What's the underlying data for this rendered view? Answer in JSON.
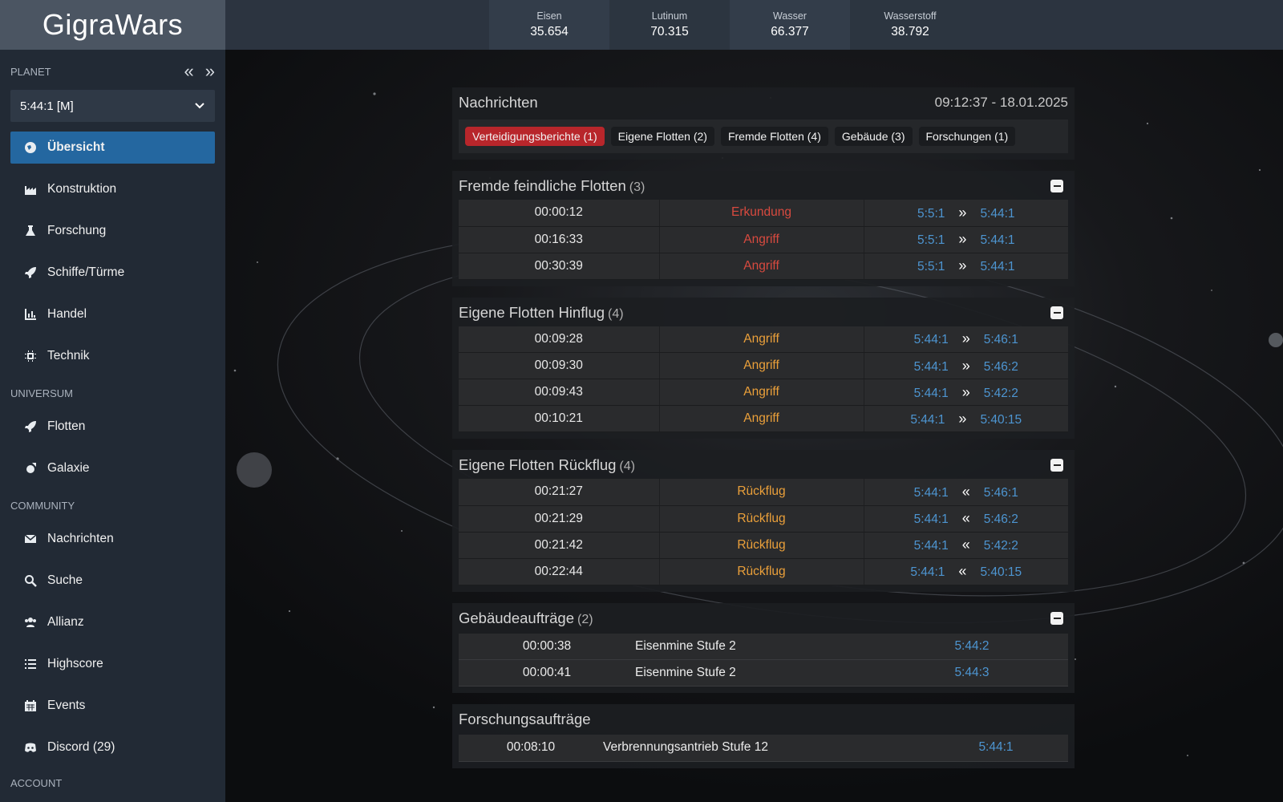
{
  "app": {
    "title": "GigraWars"
  },
  "sidebar": {
    "planet_label": "PLANET",
    "planet_value": "5:44:1 [M]",
    "prev_icon": "«",
    "next_icon": "»",
    "nav_main": [
      {
        "label": "Übersicht",
        "icon": "globe-icon",
        "active": true
      },
      {
        "label": "Konstruktion",
        "icon": "factory-icon"
      },
      {
        "label": "Forschung",
        "icon": "flask-icon"
      },
      {
        "label": "Schiffe/Türme",
        "icon": "rocket-icon"
      },
      {
        "label": "Handel",
        "icon": "chart-icon"
      },
      {
        "label": "Technik",
        "icon": "chip-icon"
      }
    ],
    "universum_label": "UNIVERSUM",
    "nav_universum": [
      {
        "label": "Flotten",
        "icon": "rocket-icon"
      },
      {
        "label": "Galaxie",
        "icon": "galaxy-icon"
      }
    ],
    "community_label": "COMMUNITY",
    "nav_community": [
      {
        "label": "Nachrichten",
        "icon": "envelope-icon"
      },
      {
        "label": "Suche",
        "icon": "search-icon"
      },
      {
        "label": "Allianz",
        "icon": "users-icon"
      },
      {
        "label": "Highscore",
        "icon": "list-icon"
      },
      {
        "label": "Events",
        "icon": "calendar-icon"
      },
      {
        "label": "Discord (29)",
        "icon": "discord-icon"
      }
    ],
    "account_label": "ACCOUNT"
  },
  "resources": [
    {
      "name": "Eisen",
      "value": "35.654"
    },
    {
      "name": "Lutinum",
      "value": "70.315"
    },
    {
      "name": "Wasser",
      "value": "66.377"
    },
    {
      "name": "Wasserstoff",
      "value": "38.792"
    }
  ],
  "messages": {
    "title": "Nachrichten",
    "timestamp": "09:12:37 - 18.01.2025",
    "tabs": [
      {
        "label": "Verteidigungsberichte (1)",
        "alert": true
      },
      {
        "label": "Eigene Flotten (2)"
      },
      {
        "label": "Fremde Flotten (4)"
      },
      {
        "label": "Gebäude (3)"
      },
      {
        "label": "Forschungen (1)"
      }
    ]
  },
  "hostile_fleets": {
    "title": "Fremde feindliche Flotten",
    "count": "(3)",
    "rows": [
      {
        "time": "00:00:12",
        "mission": "Erkundung",
        "from": "5:5:1",
        "dir": "»",
        "to": "5:44:1"
      },
      {
        "time": "00:16:33",
        "mission": "Angriff",
        "from": "5:5:1",
        "dir": "»",
        "to": "5:44:1"
      },
      {
        "time": "00:30:39",
        "mission": "Angriff",
        "from": "5:5:1",
        "dir": "»",
        "to": "5:44:1"
      }
    ]
  },
  "own_outbound": {
    "title": "Eigene Flotten Hinflug",
    "count": "(4)",
    "rows": [
      {
        "time": "00:09:28",
        "mission": "Angriff",
        "from": "5:44:1",
        "dir": "»",
        "to": "5:46:1"
      },
      {
        "time": "00:09:30",
        "mission": "Angriff",
        "from": "5:44:1",
        "dir": "»",
        "to": "5:46:2"
      },
      {
        "time": "00:09:43",
        "mission": "Angriff",
        "from": "5:44:1",
        "dir": "»",
        "to": "5:42:2"
      },
      {
        "time": "00:10:21",
        "mission": "Angriff",
        "from": "5:44:1",
        "dir": "»",
        "to": "5:40:15"
      }
    ]
  },
  "own_return": {
    "title": "Eigene Flotten Rückflug",
    "count": "(4)",
    "rows": [
      {
        "time": "00:21:27",
        "mission": "Rückflug",
        "from": "5:44:1",
        "dir": "«",
        "to": "5:46:1"
      },
      {
        "time": "00:21:29",
        "mission": "Rückflug",
        "from": "5:44:1",
        "dir": "«",
        "to": "5:46:2"
      },
      {
        "time": "00:21:42",
        "mission": "Rückflug",
        "from": "5:44:1",
        "dir": "«",
        "to": "5:42:2"
      },
      {
        "time": "00:22:44",
        "mission": "Rückflug",
        "from": "5:44:1",
        "dir": "«",
        "to": "5:40:15"
      }
    ]
  },
  "building_jobs": {
    "title": "Gebäudeaufträge",
    "count": "(2)",
    "rows": [
      {
        "time": "00:00:38",
        "name": "Eisenmine Stufe 2",
        "planet": "5:44:2"
      },
      {
        "time": "00:00:41",
        "name": "Eisenmine Stufe 2",
        "planet": "5:44:3"
      }
    ]
  },
  "research_jobs": {
    "title": "Forschungsaufträge",
    "rows": [
      {
        "time": "00:08:10",
        "name": "Verbrennungsantrieb Stufe 12",
        "planet": "5:44:1"
      }
    ]
  },
  "colors": {
    "hostile": "#d84a3f",
    "own": "#eba03a",
    "link": "#4d95d1",
    "active_nav": "#2467a0",
    "alert_tab": "#b8262b"
  }
}
